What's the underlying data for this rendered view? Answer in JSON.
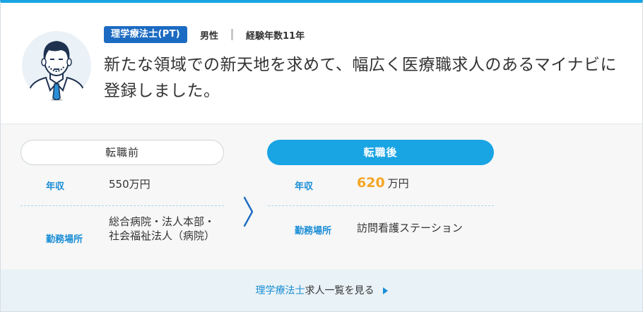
{
  "profile": {
    "qualification": "理学療法士(PT)",
    "gender": "男性",
    "experience": "経験年数11年",
    "headline": "新たな領域での新天地を求めて、幅広く医療職求人のあるマイナビに登録しました。"
  },
  "before": {
    "title": "転職前",
    "salary_label": "年収",
    "salary_value": "550万円",
    "workplace_label": "勤務場所",
    "workplace_value": "総合病院・法人本部・社会福祉法人（病院）"
  },
  "after": {
    "title": "転職後",
    "salary_label": "年収",
    "salary_amount": "620",
    "salary_unit": "万円",
    "workplace_label": "勤務場所",
    "workplace_value": "訪問看護ステーション"
  },
  "footer": {
    "job_type": "理学療法士",
    "link_suffix": "求人一覧を見る"
  },
  "icons": {
    "avatar": "male-avatar-illustration",
    "arrow": "chevron-right-icon",
    "footer_arrow": "triangle-right-icon"
  },
  "colors": {
    "accent": "#19a4e3",
    "badge": "#1c6bc2",
    "label_blue": "#1a8ed6",
    "salary_highlight": "#f5a623"
  }
}
